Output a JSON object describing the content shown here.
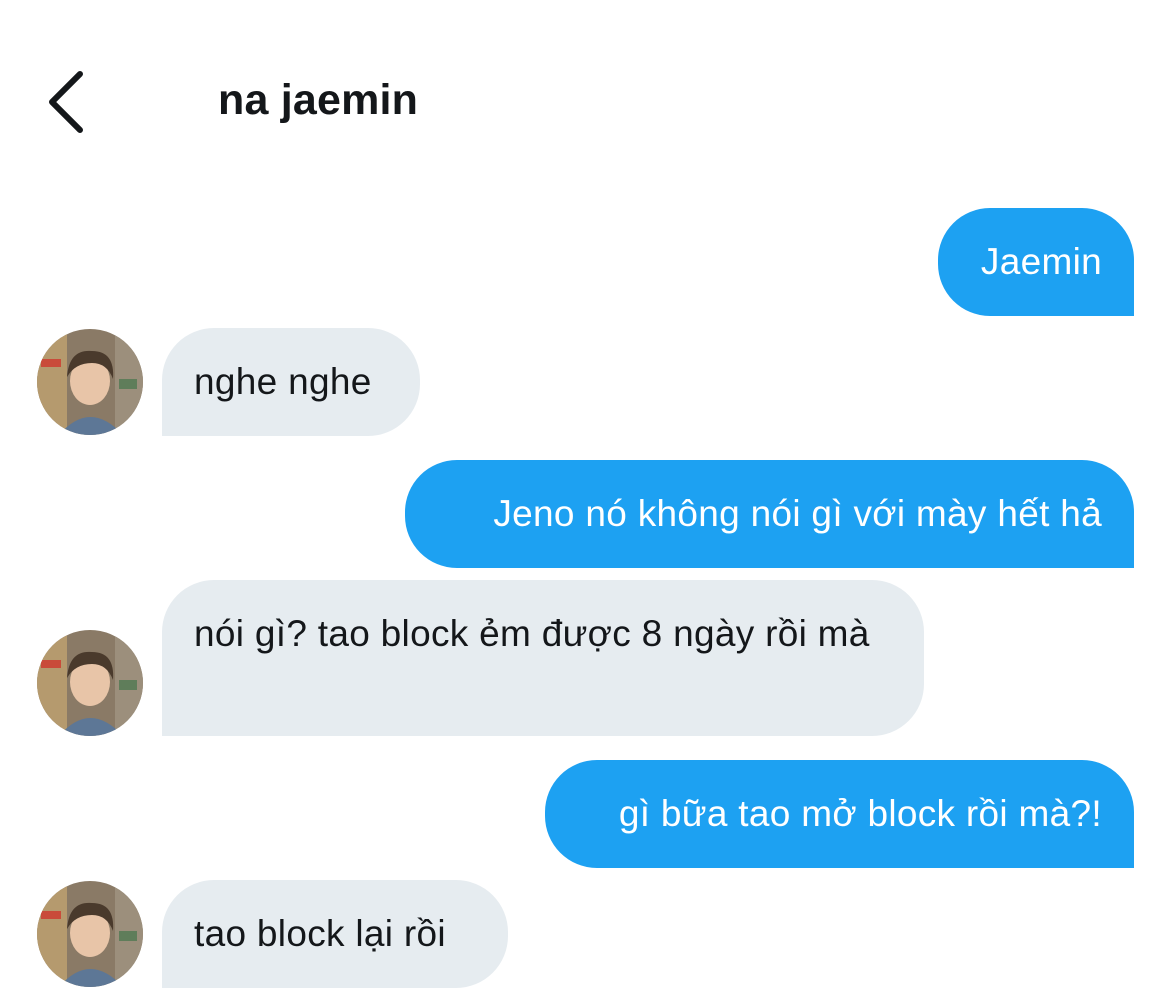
{
  "header": {
    "back_icon": "chevron-left-icon",
    "title": "na jaemin"
  },
  "colors": {
    "sent_bubble": "#1da1f2",
    "received_bubble": "#e6ecf0",
    "text": "#14171a"
  },
  "messages": [
    {
      "direction": "sent",
      "text": "Jaemin"
    },
    {
      "direction": "received",
      "text": "nghe nghe",
      "avatar": "profile-photo-avatar"
    },
    {
      "direction": "sent",
      "text": "Jeno nó không nói gì với mày hết hả"
    },
    {
      "direction": "received",
      "text": "nói gì? tao block ẻm được 8 ngày rồi mà",
      "avatar": "profile-photo-avatar"
    },
    {
      "direction": "sent",
      "text": "gì bữa tao mở block rồi mà?!"
    },
    {
      "direction": "received",
      "text": "tao block lại rồi",
      "avatar": "profile-photo-avatar"
    }
  ]
}
